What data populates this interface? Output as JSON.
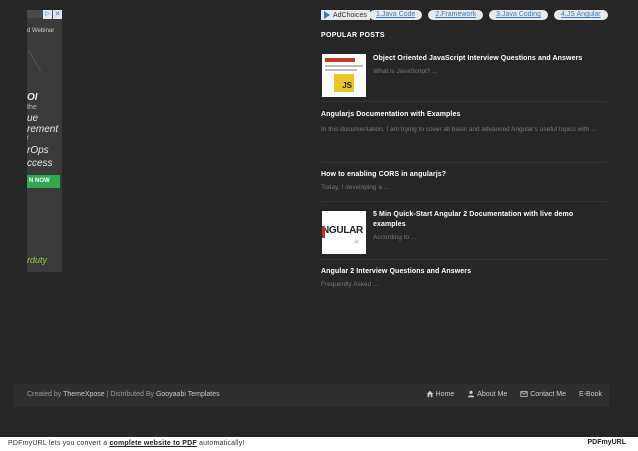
{
  "left_ad": {
    "close_symbol": "✕",
    "adchoices_symbol": "▷",
    "heading": "d Webinar",
    "line1": "OI",
    "line2": "the",
    "line3": "ue",
    "line4": "rement",
    "line5": "f",
    "line6": "rOps",
    "line7": "ccess",
    "cta": "N NOW",
    "brand": "rduty"
  },
  "ad_bar": {
    "adchoices_label": "AdChoices",
    "links": [
      "1.Java Code",
      "2.Framework",
      "3.Java Coding",
      "4.JS Angular"
    ]
  },
  "popular_posts": {
    "title": "POPULAR POSTS",
    "posts": [
      {
        "title": "Object Oriented JavaScript Interview Questions and Answers",
        "snippet": "What is JavaScript? ...",
        "thumb_text": "JS",
        "thumb_label": "JavaScript"
      },
      {
        "title": "Angularjs Documentation with Examples",
        "snippet": "In this documentation, I am trying to cover all basic and advanced Angular's useful topics with ..."
      },
      {
        "title": "How to enabling CORS in angularjs?",
        "snippet": "Today, I developing a ..."
      },
      {
        "title": "5 Min Quick-Start Angular 2 Documentation with live demo examples",
        "snippet": "According to ...",
        "thumb_text": "NGULAR",
        "thumb_sub": "JS"
      },
      {
        "title": "Angular 2 Interview Questions and Answers",
        "snippet": "Frequently Asked ..."
      }
    ]
  },
  "footer": {
    "created_by": "Created by ",
    "author": "ThemeXpose",
    "distributed": " | Distributed By ",
    "distributor": "Gooyaabi Templates",
    "nav": [
      {
        "label": "Home",
        "icon": "home-icon"
      },
      {
        "label": "About Me",
        "icon": "user-icon"
      },
      {
        "label": "Contact Me",
        "icon": "envelope-icon"
      },
      {
        "label": "E-Book",
        "icon": ""
      }
    ]
  },
  "pdf_banner": {
    "before": "PDFmyURL lets you convert a ",
    "link": "complete website to PDF",
    "after": " automatically!",
    "logo": "PDFmyURL"
  }
}
